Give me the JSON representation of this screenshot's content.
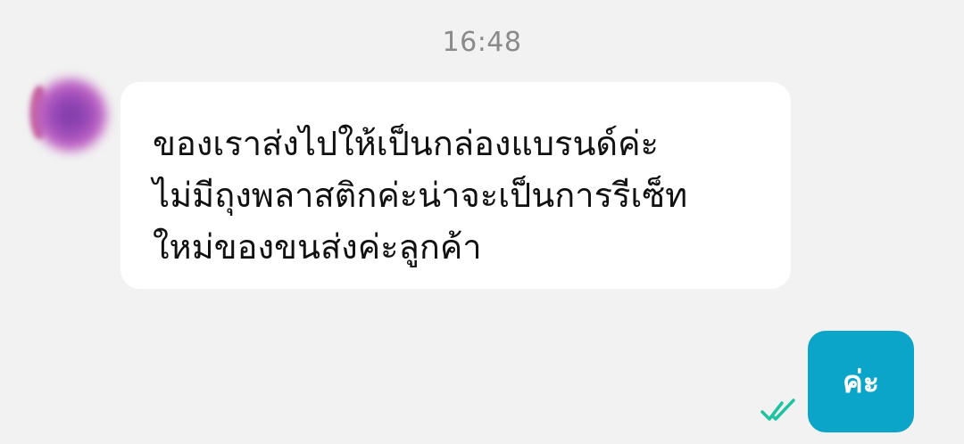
{
  "chat": {
    "timestamp": "16:48",
    "incoming": {
      "lines": [
        "ของเราส่งไปให้เป็นกล่องแบรนด์ค่ะ",
        "ไม่มีถุงพลาสติกค่ะน่าจะเป็นการรีเซ็ท",
        "ใหม่ของขนส่งค่ะลูกค้า"
      ]
    },
    "outgoing": {
      "text": "ค่ะ",
      "status_icon": "double-check-read-icon"
    }
  },
  "colors": {
    "background": "#f2f2f2",
    "incoming_bubble": "#ffffff",
    "outgoing_bubble": "#0aa5c9",
    "read_check": "#1fc3a2",
    "timestamp_text": "#8a8a8a"
  }
}
